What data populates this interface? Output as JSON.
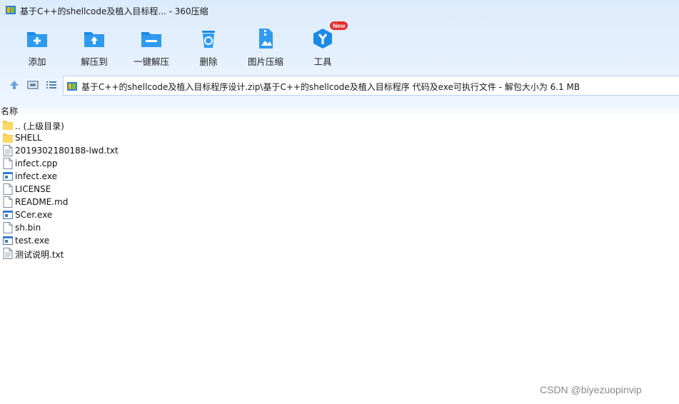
{
  "window": {
    "title": "基于C++的shellcode及植入目标程... - 360压缩"
  },
  "toolbar": {
    "items": [
      {
        "label": "添加",
        "icon": "add-folder-icon"
      },
      {
        "label": "解压到",
        "icon": "extract-to-icon"
      },
      {
        "label": "一键解压",
        "icon": "one-click-extract-icon"
      },
      {
        "label": "删除",
        "icon": "delete-icon"
      },
      {
        "label": "图片压缩",
        "icon": "image-compress-icon"
      },
      {
        "label": "工具",
        "icon": "tools-icon",
        "badge": "New"
      }
    ]
  },
  "address": {
    "path": "基于C++的shellcode及植入目标程序设计.zip\\基于C++的shellcode及植入目标程序 代码及exe可执行文件 - 解包大小为 6.1 MB"
  },
  "list": {
    "column_name": "名称",
    "files": [
      {
        "name": ".. (上级目录)",
        "type": "folder"
      },
      {
        "name": "SHELL",
        "type": "folder"
      },
      {
        "name": "2019302180188-lwd.txt",
        "type": "text"
      },
      {
        "name": "infect.cpp",
        "type": "file"
      },
      {
        "name": "infect.exe",
        "type": "exe"
      },
      {
        "name": "LICENSE",
        "type": "file"
      },
      {
        "name": "README.md",
        "type": "file"
      },
      {
        "name": "SCer.exe",
        "type": "exe"
      },
      {
        "name": "sh.bin",
        "type": "file"
      },
      {
        "name": "test.exe",
        "type": "exe"
      },
      {
        "name": "测试说明.txt",
        "type": "text"
      }
    ]
  },
  "watermark": "CSDN @biyezuopinvip",
  "colors": {
    "accent": "#1b8ae6",
    "header_bg": "#dcebfb",
    "badge": "#e52b2b"
  }
}
